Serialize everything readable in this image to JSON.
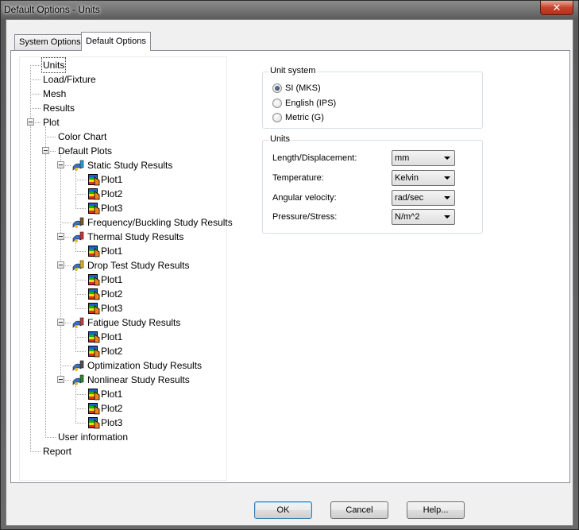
{
  "window": {
    "title": "Default Options - Units",
    "close_symbol": "✕"
  },
  "tabs": [
    {
      "label": "System Options",
      "active": false
    },
    {
      "label": "Default Options",
      "active": true
    }
  ],
  "tree": {
    "units": "Units",
    "load_fixture": "Load/Fixture",
    "mesh": "Mesh",
    "results": "Results",
    "plot": "Plot",
    "color_chart": "Color Chart",
    "default_plots": "Default Plots",
    "static": "Static Study Results",
    "static_plots": [
      "Plot1",
      "Plot2",
      "Plot3"
    ],
    "frequency": "Frequency/Buckling Study Results",
    "thermal": "Thermal Study Results",
    "thermal_plots": [
      "Plot1"
    ],
    "drop": "Drop Test Study Results",
    "drop_plots": [
      "Plot1",
      "Plot2",
      "Plot3"
    ],
    "fatigue": "Fatigue Study Results",
    "fatigue_plots": [
      "Plot1",
      "Plot2"
    ],
    "optimization": "Optimization Study Results",
    "nonlinear": "Nonlinear Study Results",
    "nonlinear_plots": [
      "Plot1",
      "Plot2",
      "Plot3"
    ],
    "user_information": "User information",
    "report": "Report",
    "selected": "Units"
  },
  "unit_system": {
    "title": "Unit system",
    "options": [
      "SI (MKS)",
      "English (IPS)",
      "Metric (G)"
    ],
    "selected": "SI (MKS)"
  },
  "units": {
    "title": "Units",
    "rows": [
      {
        "label": "Length/Displacement:",
        "value": "mm"
      },
      {
        "label": "Temperature:",
        "value": "Kelvin"
      },
      {
        "label": "Angular velocity:",
        "value": "rad/sec"
      },
      {
        "label": "Pressure/Stress:",
        "value": "N/m^2"
      }
    ]
  },
  "buttons": {
    "ok": "OK",
    "cancel": "Cancel",
    "help": "Help..."
  }
}
